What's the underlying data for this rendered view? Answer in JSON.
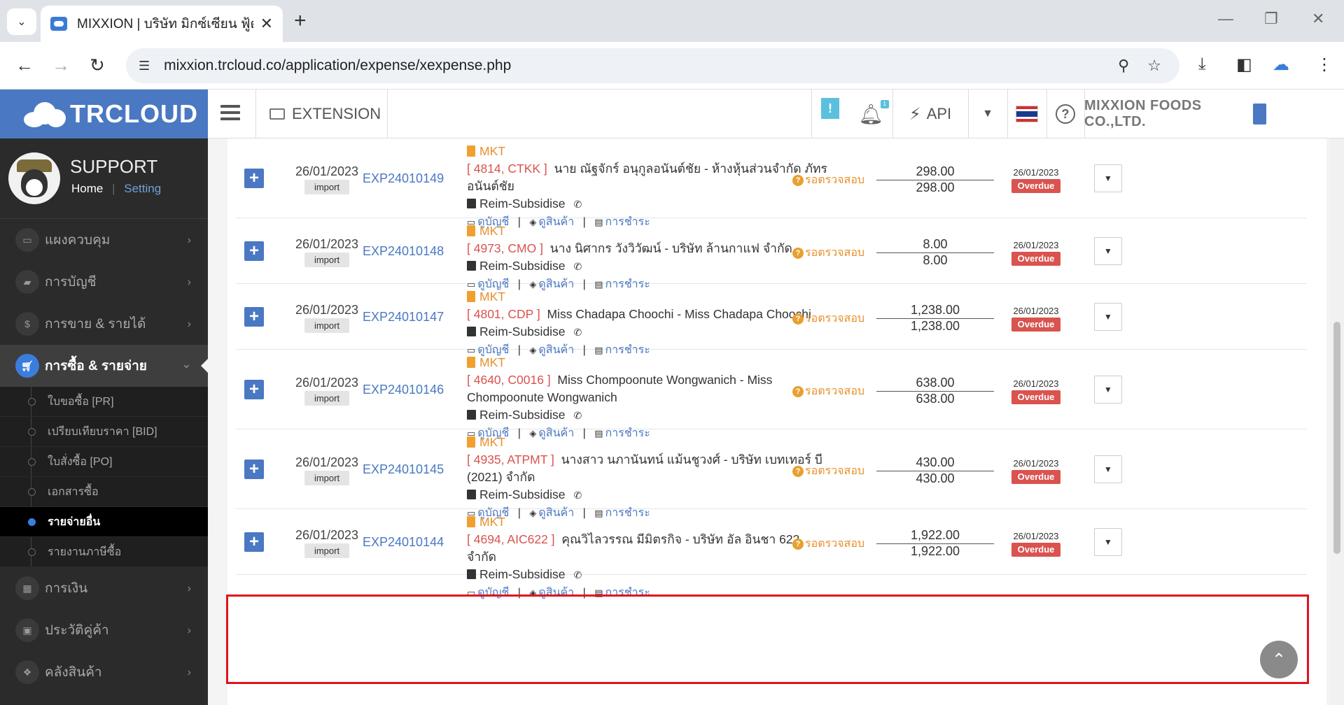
{
  "browser": {
    "tab_title": "MIXXION | บริษัท มิกซ์เซียน ฟู้ดส์ จำกัด",
    "url": "mixxion.trcloud.co/application/expense/xexpense.php"
  },
  "header": {
    "logo": "TRCLOUD",
    "extension": "EXTENSION",
    "alert": "!",
    "bell_badge": "1",
    "api": "API",
    "company": "MIXXION FOODS CO.,LTD."
  },
  "profile": {
    "name": "SUPPORT",
    "home": "Home",
    "separator": "|",
    "setting": "Setting"
  },
  "sidebar": {
    "items_top": [
      "แผงควบคุม",
      "การบัญชี",
      "การขาย & รายได้"
    ],
    "active": "การซื้อ & รายจ่าย",
    "sub": [
      "ใบขอซื้อ [PR]",
      "เปรียบเทียบราคา [BID]",
      "ใบสั่งซื้อ [PO]",
      "เอกสารซื้อ",
      "รายจ่ายอื่น",
      "รายงานภาษีซื้อ"
    ],
    "items_bottom": [
      "การเงิน",
      "ประวัติคู่ค้า",
      "คลังสินค้า"
    ]
  },
  "labels": {
    "import": "import",
    "mkt": "MKT",
    "category": "Reim-Subsidise",
    "view_account": "ดูบัญชี",
    "view_product": "ดูสินค้า",
    "payment": "การชำระ",
    "status": "รอตรวจสอบ",
    "overdue": "Overdue",
    "pipe": "|"
  },
  "rows": [
    {
      "date": "26/01/2023",
      "doc": "EXP24010149",
      "code": "[ 4814, CTKK ]",
      "vendor": "นาย ณัฐจักร์ อนุกูลอนันต์ชัย - ห้างหุ้นส่วนจำกัด ภัทรอนันต์ชัย",
      "amount": "298.00",
      "amount2": "298.00",
      "due": "26/01/2023"
    },
    {
      "date": "26/01/2023",
      "doc": "EXP24010148",
      "code": "[ 4973, CMO ]",
      "vendor": "นาง นิศากร วังวิวัฒน์ - บริษัท ล้านกาแฟ จำกัด",
      "amount": "8.00",
      "amount2": "8.00",
      "due": "26/01/2023"
    },
    {
      "date": "26/01/2023",
      "doc": "EXP24010147",
      "code": "[ 4801, CDP ]",
      "vendor": "Miss Chadapa Choochi - Miss Chadapa Choochi",
      "amount": "1,238.00",
      "amount2": "1,238.00",
      "due": "26/01/2023"
    },
    {
      "date": "26/01/2023",
      "doc": "EXP24010146",
      "code": "[ 4640, C0016 ]",
      "vendor": "Miss Chompoonute Wongwanich - Miss Chompoonute Wongwanich",
      "amount": "638.00",
      "amount2": "638.00",
      "due": "26/01/2023"
    },
    {
      "date": "26/01/2023",
      "doc": "EXP24010145",
      "code": "[ 4935, ATPMT ]",
      "vendor": "นางสาว นภานันทน์ แม้นชูวงศ์ - บริษัท เบทเทอร์ บี (2021) จำกัด",
      "amount": "430.00",
      "amount2": "430.00",
      "due": "26/01/2023"
    },
    {
      "date": "26/01/2023",
      "doc": "EXP24010144",
      "code": "[ 4694, AIC622 ]",
      "vendor": "คุณวิไลวรรณ มีมิตรกิจ - บริษัท อัล อินชา 622 จำกัด",
      "amount": "1,922.00",
      "amount2": "1,922.00",
      "due": "26/01/2023"
    }
  ]
}
